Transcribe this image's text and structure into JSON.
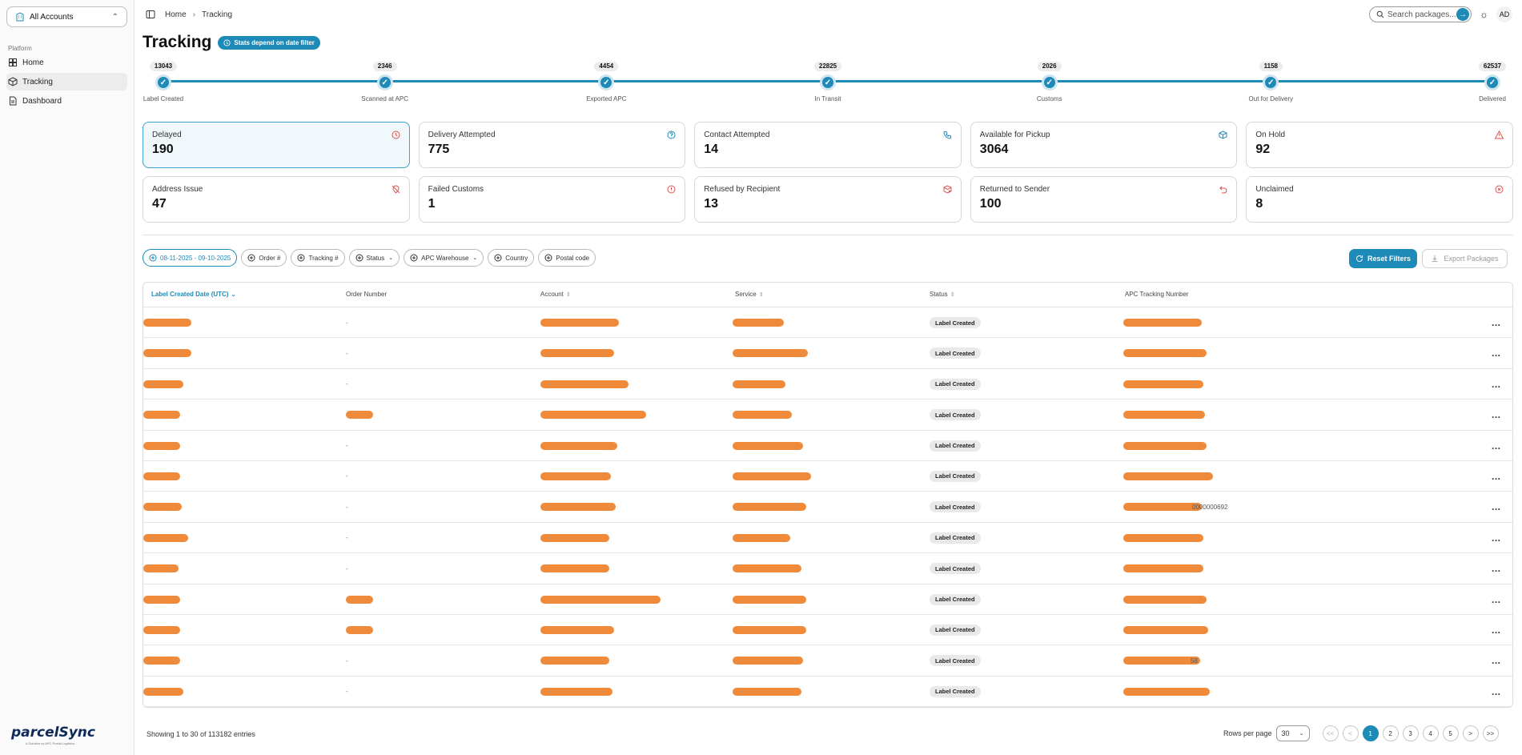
{
  "sidebar": {
    "account_selector": "All Accounts",
    "group_label": "Platform",
    "items": [
      {
        "label": "Home",
        "icon": "home-icon"
      },
      {
        "label": "Tracking",
        "icon": "package-icon"
      },
      {
        "label": "Dashboard",
        "icon": "document-icon"
      }
    ],
    "logo_text": "parcelSync",
    "logo_tagline": "A Solution by APC Postal Logistics"
  },
  "topbar": {
    "breadcrumb": [
      "Home",
      "Tracking"
    ],
    "search_placeholder": "Search packages...",
    "avatar_initials": "AD"
  },
  "page": {
    "title": "Tracking",
    "stats_badge": "Stats depend on date filter"
  },
  "timeline": [
    {
      "count": "13043",
      "label": "Label Created"
    },
    {
      "count": "2346",
      "label": "Scanned at APC"
    },
    {
      "count": "4454",
      "label": "Exported APC"
    },
    {
      "count": "22825",
      "label": "In Transit"
    },
    {
      "count": "2026",
      "label": "Customs"
    },
    {
      "count": "1158",
      "label": "Out for Delivery"
    },
    {
      "count": "62537",
      "label": "Delivered"
    }
  ],
  "cards": [
    {
      "label": "Delayed",
      "value": "190",
      "icon": "clock-icon",
      "color": "#d9534f"
    },
    {
      "label": "Delivery Attempted",
      "value": "775",
      "icon": "help-circle-icon",
      "color": "#1e8ab8"
    },
    {
      "label": "Contact Attempted",
      "value": "14",
      "icon": "phone-icon",
      "color": "#1e8ab8"
    },
    {
      "label": "Available for Pickup",
      "value": "3064",
      "icon": "box-icon",
      "color": "#1e8ab8"
    },
    {
      "label": "On Hold",
      "value": "92",
      "icon": "alert-triangle-icon",
      "color": "#d9534f"
    },
    {
      "label": "Address Issue",
      "value": "47",
      "icon": "map-pin-off-icon",
      "color": "#d9534f"
    },
    {
      "label": "Failed Customs",
      "value": "1",
      "icon": "alert-circle-icon",
      "color": "#d9534f"
    },
    {
      "label": "Refused by Recipient",
      "value": "13",
      "icon": "package-x-icon",
      "color": "#d9534f"
    },
    {
      "label": "Returned to Sender",
      "value": "100",
      "icon": "undo-icon",
      "color": "#d9534f"
    },
    {
      "label": "Unclaimed",
      "value": "8",
      "icon": "x-circle-icon",
      "color": "#d9534f"
    }
  ],
  "filters": {
    "chips": [
      {
        "label": "08-11-2025 - 09-10-2025",
        "active": true,
        "dropdown": false
      },
      {
        "label": "Order #",
        "active": false,
        "dropdown": false
      },
      {
        "label": "Tracking #",
        "active": false,
        "dropdown": false
      },
      {
        "label": "Status",
        "active": false,
        "dropdown": true
      },
      {
        "label": "APC Warehouse",
        "active": false,
        "dropdown": true
      },
      {
        "label": "Country",
        "active": false,
        "dropdown": false
      },
      {
        "label": "Postal code",
        "active": false,
        "dropdown": false
      }
    ],
    "reset_label": "Reset Filters",
    "export_label": "Export Packages"
  },
  "table": {
    "columns": [
      "Label Created Date (UTC)",
      "Order Number",
      "Account",
      "Service",
      "Status",
      "APC Tracking Number"
    ],
    "rows": [
      {
        "order": "-",
        "status": "Label Created",
        "tracking_visible": ""
      },
      {
        "order": "-",
        "status": "Label Created",
        "tracking_visible": ""
      },
      {
        "order": "-",
        "status": "Label Created",
        "tracking_visible": ""
      },
      {
        "order": "",
        "status": "Label Created",
        "tracking_visible": ""
      },
      {
        "order": "-",
        "status": "Label Created",
        "tracking_visible": ""
      },
      {
        "order": "-",
        "status": "Label Created",
        "tracking_visible": ""
      },
      {
        "order": "-",
        "status": "Label Created",
        "tracking_visible": "0000000692"
      },
      {
        "order": "-",
        "status": "Label Created",
        "tracking_visible": ""
      },
      {
        "order": "-",
        "status": "Label Created",
        "tracking_visible": ""
      },
      {
        "order": "",
        "status": "Label Created",
        "tracking_visible": ""
      },
      {
        "order": "",
        "status": "Label Created",
        "tracking_visible": ""
      },
      {
        "order": "-",
        "status": "Label Created",
        "tracking_visible": "58"
      },
      {
        "order": "-",
        "status": "Label Created",
        "tracking_visible": ""
      }
    ],
    "row_menu": "..."
  },
  "footer": {
    "showing": "Showing 1 to 30 of 113182 entries",
    "rows_per_page_label": "Rows per page",
    "rows_per_page": "30",
    "pages": [
      "1",
      "2",
      "3",
      "4",
      "5"
    ],
    "first": "<<",
    "prev": "<",
    "next": ">",
    "last": ">>"
  },
  "colors": {
    "accent": "#1e8ab8",
    "danger": "#d9534f",
    "redaction": "#ee8a3a"
  }
}
